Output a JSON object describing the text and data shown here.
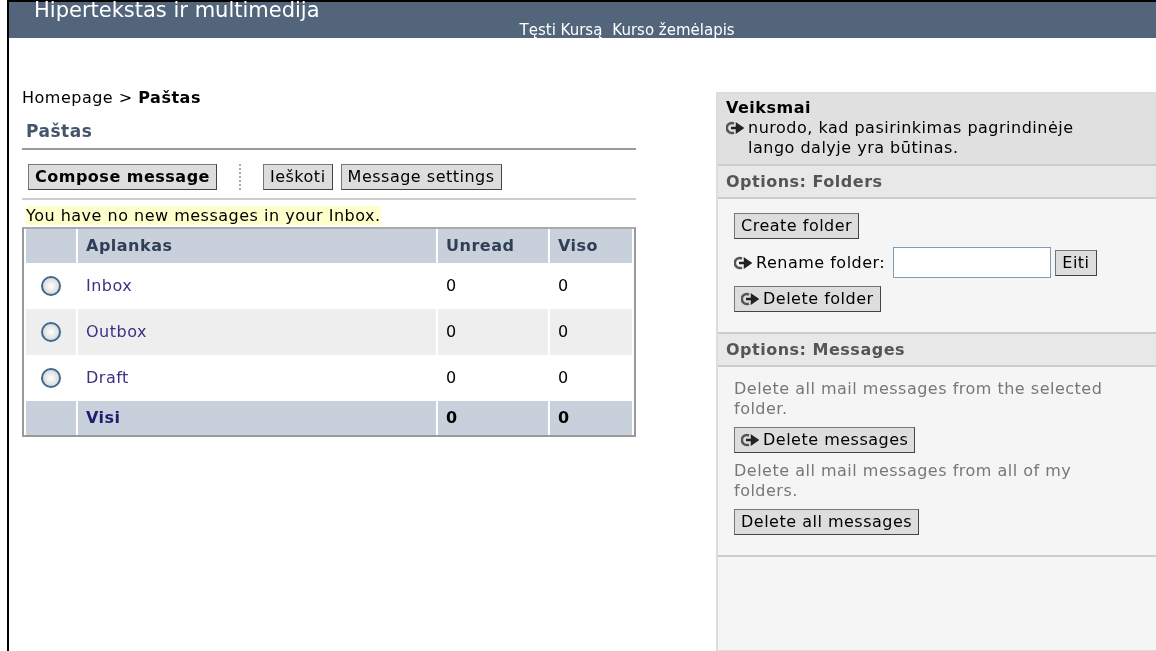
{
  "header": {
    "title": "Hipertekstas ir multimedija",
    "links": [
      "Tęsti Kursą",
      "Kurso žemėlapis"
    ]
  },
  "breadcrumb": {
    "home": "Homepage",
    "separator": ">",
    "current": "Paštas"
  },
  "main": {
    "heading": "Paštas",
    "buttons": [
      {
        "label": "Compose message",
        "bold": true
      },
      {
        "label": "Ieškoti",
        "bold": false
      },
      {
        "label": "Message settings",
        "bold": false
      }
    ],
    "notice": "You have no new messages in your Inbox.",
    "table": {
      "columns": [
        "Aplankas",
        "Unread",
        "Viso"
      ],
      "rows": [
        {
          "name": "Inbox",
          "unread": "0",
          "total": "0",
          "selected": false
        },
        {
          "name": "Outbox",
          "unread": "0",
          "total": "0",
          "selected": false
        },
        {
          "name": "Draft",
          "unread": "0",
          "total": "0",
          "selected": false
        }
      ],
      "footer": {
        "name": "Visi",
        "unread": "0",
        "total": "0"
      }
    }
  },
  "sidebar": {
    "title": "Veiksmai",
    "note": "nurodo, kad pasirinkimas pagrindinėje lango dalyje yra būtinas.",
    "sections": [
      {
        "title": "Options: Folders",
        "items": [
          {
            "kind": "button",
            "label": "Create folder",
            "needs_selection": false
          },
          {
            "kind": "rename",
            "label": "Rename folder:",
            "go": "Eiti",
            "needs_selection": true
          },
          {
            "kind": "button",
            "label": "Delete folder",
            "needs_selection": true
          }
        ]
      },
      {
        "title": "Options: Messages",
        "items": [
          {
            "kind": "text",
            "label": "Delete all mail messages from the selected folder."
          },
          {
            "kind": "button",
            "label": "Delete messages",
            "needs_selection": true
          },
          {
            "kind": "text",
            "label": "Delete all mail messages from all of my folders."
          },
          {
            "kind": "button",
            "label": "Delete all messages",
            "needs_selection": false
          }
        ]
      }
    ]
  }
}
